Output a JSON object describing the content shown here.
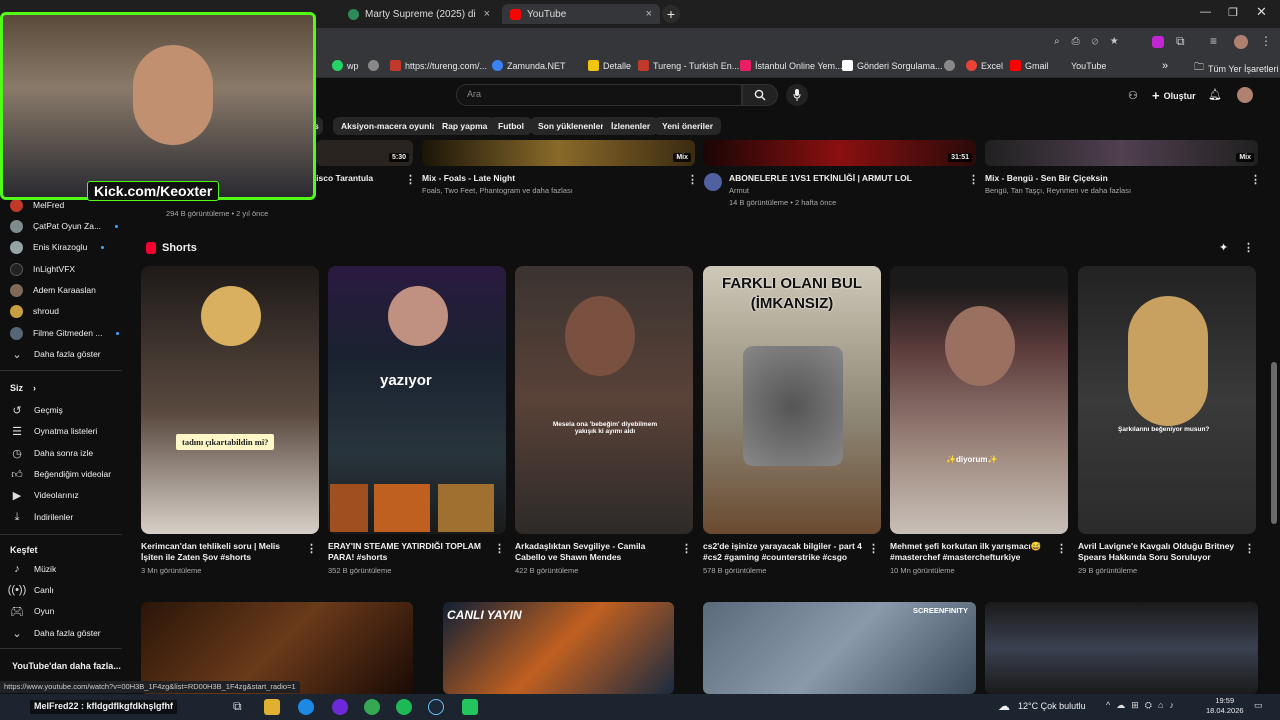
{
  "browser": {
    "tabs": [
      {
        "title": "Marty Supreme (2025) directed",
        "close": "×"
      },
      {
        "title": "YouTube",
        "close": "×"
      }
    ],
    "new_tab": "+"
  },
  "bookmarks": [
    {
      "label": "wp",
      "color": "#25d366"
    },
    {
      "label": "",
      "color": "#888888"
    },
    {
      "label": "https://tureng.com/...",
      "color": "#c0392b"
    },
    {
      "label": "Zamunda.NET",
      "color": "#3b82f6"
    },
    {
      "label": "Detalle",
      "color": "#f1c40f"
    },
    {
      "label": "Tureng - Turkish En...",
      "color": "#c0392b"
    },
    {
      "label": "İstanbul Online Yem...",
      "color": "#e91e63"
    },
    {
      "label": "Gönderi Sorgulama...",
      "color": "#ffffff"
    },
    {
      "label": "Excel",
      "color": "#888888"
    },
    {
      "label": "Gmail",
      "color": "#ea4335"
    },
    {
      "label": "YouTube",
      "color": "#ff0000"
    }
  ],
  "bookmarks_more": "»",
  "bookmarks_folder": "Tüm Yer İşaretleri",
  "header": {
    "search_placeholder": "Ara",
    "create_label": "Oluştur"
  },
  "chips": [
    "Aksiyon-macera oyunları",
    "Rap yapma",
    "Futbol",
    "Son yüklenenler",
    "İzlenenler",
    "Yeni öneriler"
  ],
  "webcam": {
    "overlay_text": "Kick.com/Keoxter"
  },
  "top_videos": [
    {
      "title": "Disco Tarantula",
      "meta1": "",
      "meta2": "294 B görüntüleme • 2 yıl önce",
      "duration": "5:30"
    },
    {
      "title": "Mix - Foals - Late Night",
      "meta1": "Foals, Two Feet, Phantogram ve daha fazlası",
      "meta2": "",
      "duration": "Mix"
    },
    {
      "title": "ABONELERLE 1VS1 ETKİNLİĞİ | ARMUT LOL",
      "meta1": "Armut",
      "meta2": "14 B görüntüleme • 2 hafta önce",
      "duration": "31:51"
    },
    {
      "title": "Mix - Bengü - Sen Bir Çiçeksin",
      "meta1": "Bengü, Tan Taşçı, Reynmen ve daha fazlası",
      "meta2": "",
      "duration": "Mix"
    }
  ],
  "sidebar": {
    "subscriptions": [
      {
        "label": "MelFred",
        "color": "#c0392b"
      },
      {
        "label": "ÇatPat Oyun Za...",
        "color": "#7f8c8d"
      },
      {
        "label": "Enis Kirazoglu",
        "color": "#95a5a6"
      },
      {
        "label": "InLightVFX",
        "color": "#222222"
      },
      {
        "label": "Adem Karaaslan",
        "color": "#7f6a5a"
      },
      {
        "label": "shroud",
        "color": "#c8a040"
      },
      {
        "label": "Filme Gitmeden ...",
        "color": "#556677"
      }
    ],
    "show_more": "Daha fazla göster",
    "you_section": "Siz",
    "you_items": [
      "Geçmiş",
      "Oynatma listeleri",
      "Daha sonra izle",
      "Beğendiğim videolar",
      "Videolarınız",
      "İndirilenler"
    ],
    "explore_section": "Keşfet",
    "explore_items": [
      "Müzik",
      "Canlı",
      "Oyun"
    ],
    "show_more_2": "Daha fazla göster",
    "more_from_youtube": "YouTube'dan daha fazla..."
  },
  "shorts": {
    "section_title": "Shorts",
    "items": [
      {
        "title": "Kerimcan'dan tehlikeli soru | Melis İşiten ile Zaten Şov #shorts",
        "views": "3 Mn görüntüleme",
        "caption": "tadını çıkartabildin mi?",
        "bg": "#3a3330"
      },
      {
        "title": "ERAY'IN STEAME YATIRDIĞI TOPLAM PARA! #shorts",
        "views": "352 B görüntüleme",
        "caption": "yazıyor",
        "bg": "#1f2a35"
      },
      {
        "title": "Arkadaşlıktan Sevgiliye - Camila Cabello ve Shawn Mendes",
        "views": "422 B görüntüleme",
        "caption": "Mesela ona 'bebeğim' diyebilmem yakışık ki ayımı aldı",
        "bg": "#2d2a28"
      },
      {
        "title": "cs2'de işinize yarayacak bilgiler - part 4 #cs2 #gaming #counterstrike #csgo",
        "views": "578 B görüntüleme",
        "caption": "FARKLI OLANI BUL (İMKANSIZ)",
        "bg": "#b8b2a2"
      },
      {
        "title": "Mehmet şefi korkutan ilk yarışmacı😅 #masterchef #masterchefturkiye",
        "views": "10 Mn görüntüleme",
        "caption": "✨diyorum✨",
        "bg": "#6a4a4a"
      },
      {
        "title": "Avril Lavigne'e Kavgalı Olduğu Britney Spears Hakkında Soru Soruluyor",
        "views": "29 B görüntüleme",
        "caption": "Şarkılarını beğeniyor musun?",
        "bg": "#2b2b2b"
      }
    ]
  },
  "bottom_thumbs": [
    {
      "label": "",
      "bg": "#4a2a1a"
    },
    {
      "label": "CANLI YAYIN",
      "bg": "#1a3550"
    },
    {
      "label": "SCREENFINITY",
      "bg": "#6a7a8a"
    },
    {
      "label": "",
      "bg": "#1a1a1a"
    }
  ],
  "statusbar_url": "https://www.youtube.com/watch?v=00H3B_1F4zg&list=RD00H3B_1F4zg&start_radio=1",
  "chat_overlay": "MelFred22 : kfldgdflkgfdkhşlgfhf",
  "taskbar": {
    "weather": "12°C  Çok bulutlu",
    "time": "19:59",
    "date": "18.04.2026"
  }
}
